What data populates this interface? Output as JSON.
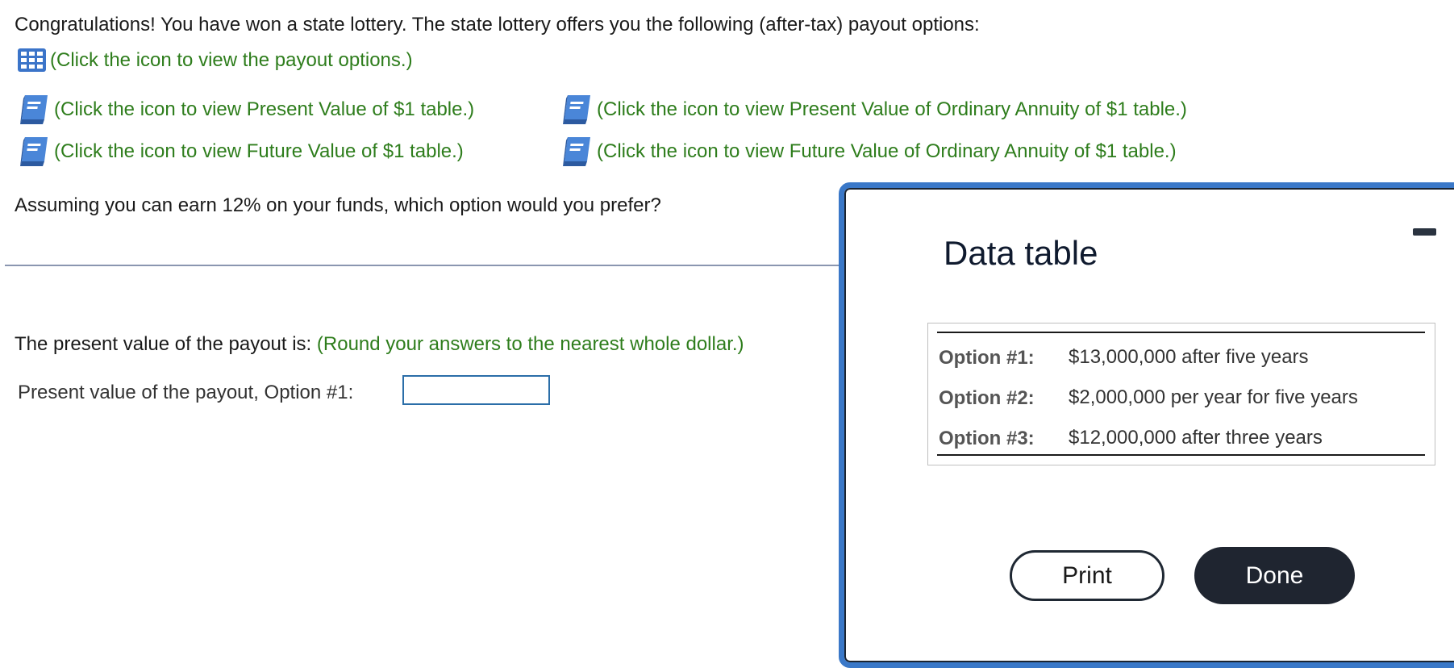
{
  "intro_text": "Congratulations! You have won a state lottery. The state lottery offers you the following (after-tax) payout options:",
  "links": {
    "payout_options": "(Click the icon to view the payout options.)",
    "pv_table": "(Click the icon to view Present Value of $1 table.)",
    "fv_table": "(Click the icon to view Future Value of $1 table.)",
    "pv_annuity_table": "(Click the icon to view Present Value of Ordinary Annuity of $1 table.)",
    "fv_annuity_table": "(Click the icon to view Future Value of Ordinary Annuity of $1 table.)"
  },
  "icons": {
    "payout_options": "grid-table-icon",
    "reference_tables": "book-icon"
  },
  "question": "Assuming you can earn 12% on your funds, which option would you prefer?",
  "present_value": {
    "prompt": "The present value of the payout is:",
    "hint": "(Round your answers to the nearest whole dollar.)",
    "option1_label": "Present value of the payout, Option #1:",
    "option1_value": ""
  },
  "dialog": {
    "title": "Data table",
    "rows": [
      {
        "label": "Option #1:",
        "value": "$13,000,000 after five years"
      },
      {
        "label": "Option #2:",
        "value": "$2,000,000 per year for five years"
      },
      {
        "label": "Option #3:",
        "value": "$12,000,000 after three years"
      }
    ],
    "print_label": "Print",
    "done_label": "Done"
  },
  "colors": {
    "link_green": "#2e7d1c",
    "dialog_border": "#3a78c8",
    "done_button": "#1f2530",
    "input_border": "#2b6ea8"
  }
}
